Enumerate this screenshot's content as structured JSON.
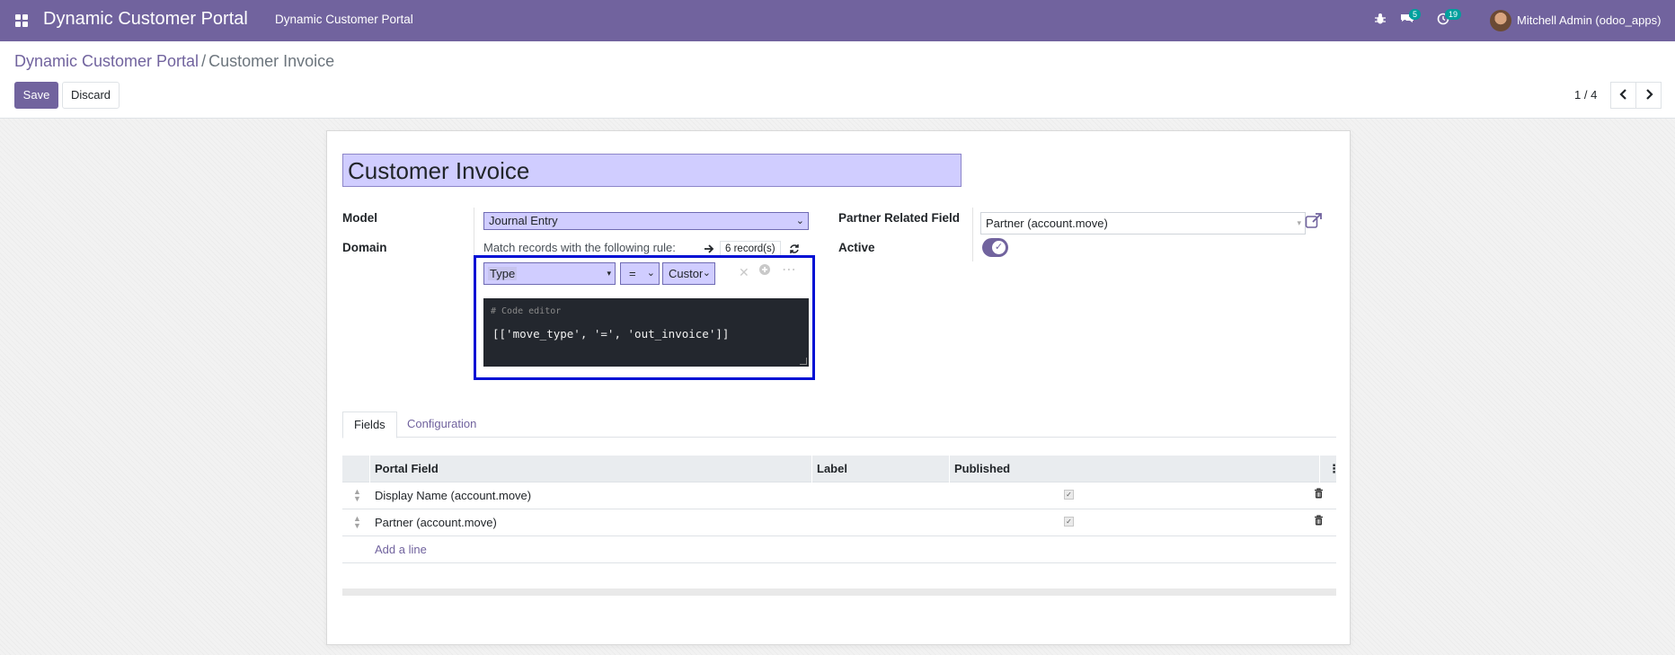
{
  "navbar": {
    "app_name": "Dynamic Customer Portal",
    "menu": "Dynamic Customer Portal",
    "chat_badge": "5",
    "activity_badge": "19",
    "user": "Mitchell Admin (odoo_apps)",
    "icons": [
      "apps-grid-icon",
      "bug-icon",
      "chat-icon",
      "clock-icon"
    ]
  },
  "control_panel": {
    "breadcrumb_parent": "Dynamic Customer Portal",
    "breadcrumb_sep": "/",
    "breadcrumb_current": "Customer Invoice",
    "save": "Save",
    "discard": "Discard",
    "pager": "1 / 4"
  },
  "form": {
    "name": "Customer Invoice",
    "model_label": "Model",
    "model_value": "Journal Entry",
    "domain_label": "Domain",
    "match_text": "Match records with the following rule:",
    "records": "6 record(s)",
    "rule_field": "Type",
    "rule_operator": "=",
    "rule_value": "Custom",
    "code_comment": "# Code editor",
    "code": "[['move_type', '=', 'out_invoice']]",
    "partner_label": "Partner Related Field",
    "partner_value": "Partner (account.move)",
    "active_label": "Active",
    "active": true
  },
  "tabs": [
    {
      "label": "Fields",
      "active": true
    },
    {
      "label": "Configuration",
      "active": false
    }
  ],
  "table": {
    "headers": [
      "Portal Field",
      "Label",
      "Published"
    ],
    "rows": [
      {
        "portal_field": "Display Name (account.move)",
        "label": "",
        "published": true
      },
      {
        "portal_field": "Partner (account.move)",
        "label": "",
        "published": true
      }
    ],
    "add_line": "Add a line"
  },
  "colors": {
    "brand": "#71639e",
    "highlight": "#0010d4",
    "input_focus": "#d0cdff"
  }
}
